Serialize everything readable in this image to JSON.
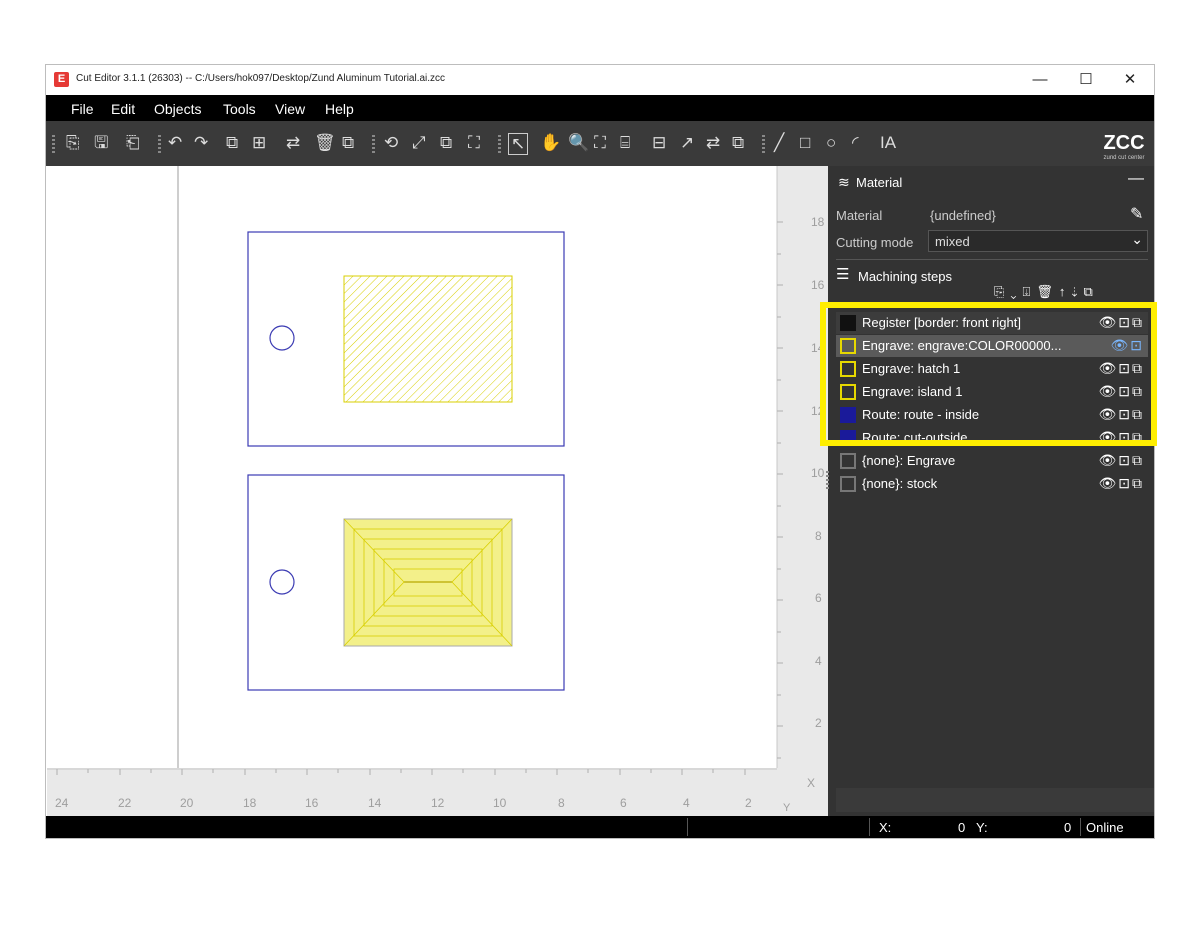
{
  "window": {
    "title": "Cut Editor 3.1.1 (26303)  --  C:/Users/hok097/Desktop/Zund Aluminum Tutorial.ai.zcc",
    "logo_letter": "E",
    "minimize": "—",
    "maximize": "☐",
    "close": "✕"
  },
  "menu": [
    "File",
    "Edit",
    "Objects",
    "Tools",
    "View",
    "Help"
  ],
  "brand": {
    "logo_text": "ZCC",
    "tagline": "zund cut center",
    "accent": "#e53935"
  },
  "ruler": {
    "x_labels": [
      "24",
      "22",
      "20",
      "18",
      "16",
      "14",
      "12",
      "10",
      "8",
      "6",
      "4",
      "2"
    ],
    "y_labels": [
      "18",
      "16",
      "14",
      "12",
      "10",
      "8",
      "6",
      "4",
      "2"
    ],
    "x_axis": "X",
    "y_axis": "Y"
  },
  "panel": {
    "material_header": "Material",
    "material_label": "Material",
    "material_value": "{undefined}",
    "cutting_mode_label": "Cutting mode",
    "cutting_mode_value": "mixed",
    "steps_header": "Machining steps",
    "steps": [
      {
        "label": "Register [border: front right]",
        "color": "#1a1a1a"
      },
      {
        "label": "Engrave: engrave:COLOR00000...",
        "color": "#e6d800"
      },
      {
        "label": "Engrave: hatch 1",
        "color": "#e6d800"
      },
      {
        "label": "Engrave: island 1",
        "color": "#e6d800"
      },
      {
        "label": "Route: route - inside",
        "color": "#1a1a9a"
      },
      {
        "label": "Route: cut-outside",
        "color": "#1a1a9a"
      },
      {
        "label": "{none}: Engrave",
        "color": "#777777"
      },
      {
        "label": "{none}: stock",
        "color": "#777777"
      }
    ]
  },
  "status": {
    "x_label": "X:",
    "x_value": "0",
    "y_label": "Y:",
    "y_value": "0",
    "connection": "Online"
  },
  "colors": {
    "highlight": "#ffee00",
    "outline": "#3b3bb3",
    "engrave_fill": "#f3f08a",
    "engrave_stroke": "#d8cf00"
  }
}
